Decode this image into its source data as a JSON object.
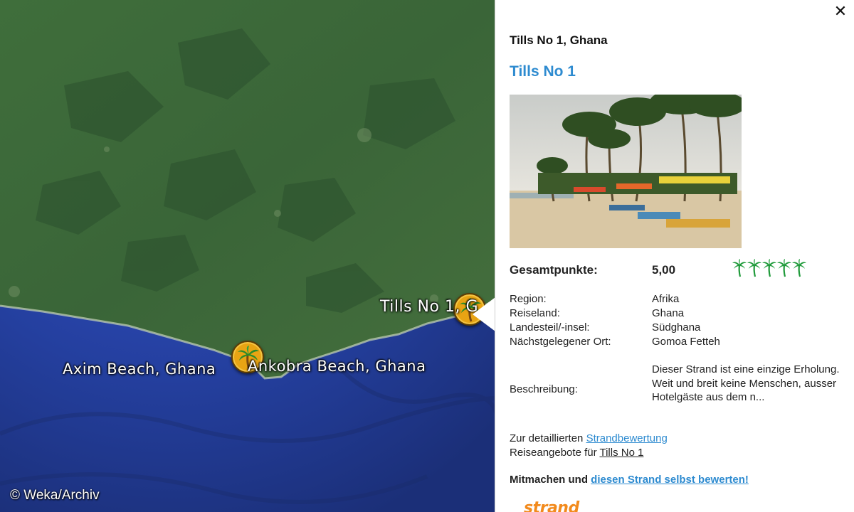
{
  "map": {
    "labels": {
      "tills": "Tills No 1, G",
      "axim": "Axim Beach, Ghana",
      "ankobra": "Ankobra Beach, Ghana"
    },
    "copyright": "© Weka/Archiv",
    "pin_icon": "palm-tree-pin-icon",
    "colors": {
      "land": "#3d6b3a",
      "ocean": "#2a47b8",
      "pin": "#e8a414"
    }
  },
  "panel": {
    "close_label": "✕",
    "subtitle": "Tills No 1, Ghana",
    "title": "Tills No 1",
    "score_label": "Gesamtpunkte:",
    "score_value": "5,00",
    "rating_palms": 5,
    "details": [
      {
        "key": "Region:",
        "value": "Afrika"
      },
      {
        "key": "Reiseland:",
        "value": "Ghana"
      },
      {
        "key": "Landesteil/-insel:",
        "value": "Südghana"
      },
      {
        "key": "Nächstgelegener Ort:",
        "value": "Gomoa Fetteh"
      }
    ],
    "description_label": "Beschreibung:",
    "description": "Dieser Strand ist eine einzige Erholung. Weit und breit keine Menschen, ausser Hotelgäste aus dem n...",
    "link1_prefix": "Zur detaillierten ",
    "link1_text": "Strandbewertung",
    "link2_prefix": "Reiseangebote für ",
    "link2_text": "Tills No 1",
    "cta_prefix": "Mitmachen und ",
    "cta_link": "diesen Strand selbst bewerten!",
    "logo_text": "strand",
    "colors": {
      "title": "#2e8bd0",
      "palm": "#1f9a3a",
      "logo": "#f28a1c"
    }
  }
}
